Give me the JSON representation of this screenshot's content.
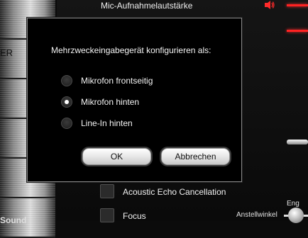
{
  "background_panel": {
    "title": "Mic-Aufnahmelautstärke",
    "left_partial_label": "ER",
    "left_bottom_partial_label": "Sound",
    "options": [
      {
        "label": "Acoustic Echo Cancellation",
        "checked": false
      },
      {
        "label": "Focus",
        "checked": false
      }
    ],
    "small_labels": {
      "eng": "Eng",
      "anstellwinkel": "Anstellwinkel"
    },
    "accent_color": "#ff2222"
  },
  "dialog": {
    "heading": "Mehrzweckeingabegerät konfigurieren als:",
    "radio_options": [
      {
        "label": "Mikrofon frontseitig",
        "selected": false
      },
      {
        "label": "Mikrofon hinten",
        "selected": true
      },
      {
        "label": "Line-In hinten",
        "selected": false
      }
    ],
    "ok_label": "OK",
    "cancel_label": "Abbrechen"
  },
  "icons": {
    "speaker": "speaker-icon"
  }
}
